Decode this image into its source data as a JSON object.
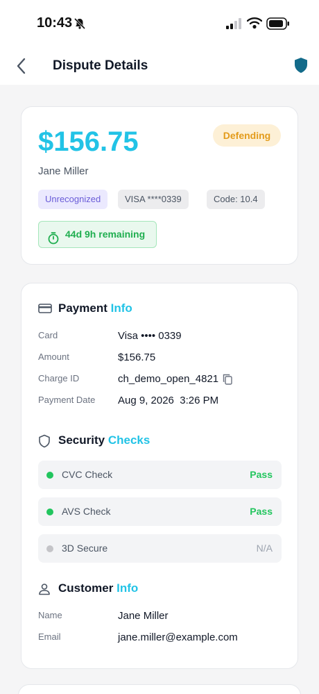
{
  "status_bar": {
    "time": "10:43"
  },
  "nav": {
    "title": "Dispute Details"
  },
  "summary": {
    "amount": "$156.75",
    "status": "Defending",
    "customer_name": "Jane Miller",
    "reason_chip": "Unrecognized",
    "card_chip": "VISA ****0339",
    "code_chip": "Code: 10.4",
    "time_remaining": "44d 9h remaining"
  },
  "payment": {
    "title_main": "Payment",
    "title_accent": "Info",
    "fields": [
      {
        "label": "Card",
        "value": "Visa •••• 0339"
      },
      {
        "label": "Amount",
        "value": "$156.75"
      },
      {
        "label": "Charge ID",
        "value": "ch_demo_open_4821"
      },
      {
        "label": "Payment Date",
        "value": "Aug 9, 2026  3:26 PM"
      }
    ]
  },
  "security": {
    "title_main": "Security",
    "title_accent": "Checks",
    "checks": [
      {
        "label": "CVC Check",
        "result": "Pass",
        "color": "#22c55e"
      },
      {
        "label": "AVS Check",
        "result": "Pass",
        "color": "#22c55e"
      },
      {
        "label": "3D Secure",
        "result": "N/A",
        "color": "#9ca3af"
      }
    ]
  },
  "customer": {
    "title_main": "Customer",
    "title_accent": "Info",
    "fields": [
      {
        "label": "Name",
        "value": "Jane Miller"
      },
      {
        "label": "Email",
        "value": "jane.miller@example.com"
      }
    ]
  },
  "colors": {
    "accent": "#22c3e6",
    "pass": "#22c55e",
    "warning": "#e39b1b",
    "shield": "#136b8a"
  }
}
